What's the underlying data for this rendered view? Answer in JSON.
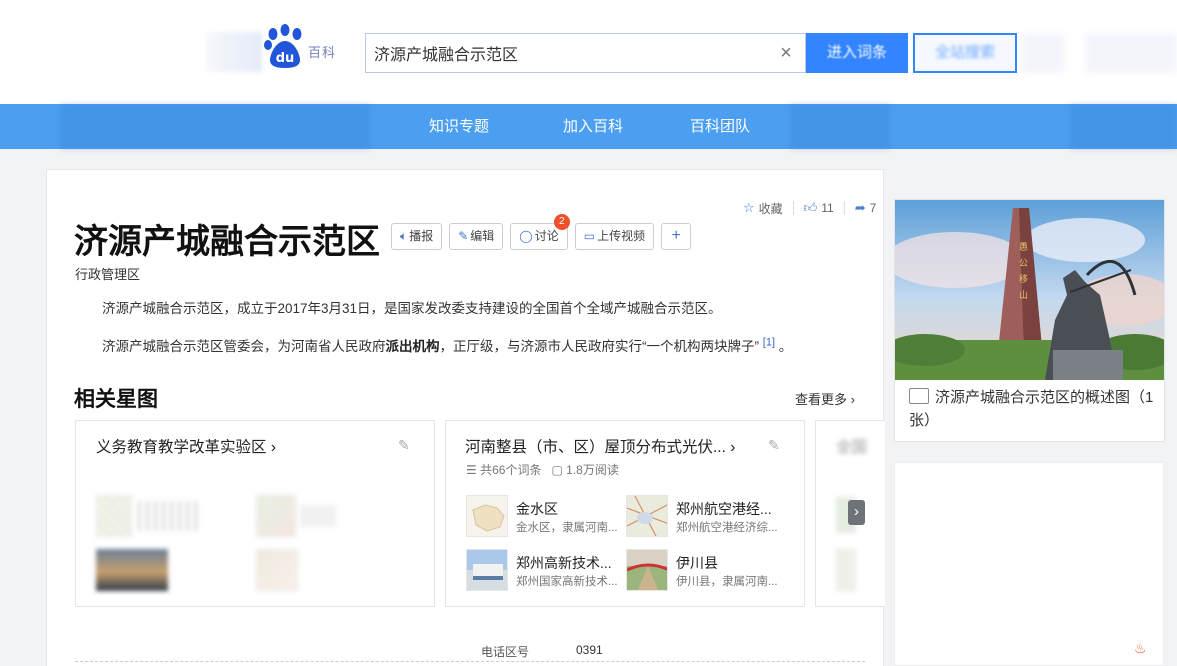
{
  "search": {
    "query": "济源产城融合示范区",
    "enter_label": "进入词条",
    "search_label": "全站搜索"
  },
  "logo": {
    "text": "du",
    "tail": "百科"
  },
  "nav": {
    "items": [
      "知识专题",
      "加入百科",
      "百科团队"
    ]
  },
  "actions": {
    "collect": "收藏",
    "like_count": "11",
    "share_count": "7"
  },
  "title": "济源产城融合示范区",
  "toolbar": {
    "play": "播报",
    "edit": "编辑",
    "discuss": "讨论",
    "discuss_badge": "2",
    "upload_video": "上传视频",
    "plus": "+"
  },
  "subtitle": "行政管理区",
  "summary": {
    "p1": "济源产城融合示范区，成立于2017年3月31日，是国家发改委支持建设的全国首个全域产城融合示范区。",
    "p2_a": "济源产城融合示范区管委会，为河南省人民政府",
    "p2_bold": "派出机构",
    "p2_b": "，正厅级，与济源市人民政府实行“一个机构两块牌子”",
    "p2_ref": "[1]",
    "p2_end": "。"
  },
  "related": {
    "section_title": "相关星图",
    "see_more": "查看更多",
    "card1": {
      "title": "义务教育教学改革实验区"
    },
    "card2": {
      "title": "河南整县（市、区）屋顶分布式光伏...",
      "count": "共66个词条",
      "reads": "1.8万阅读",
      "entries": [
        {
          "name": "金水区",
          "desc": "金水区，隶属河南..."
        },
        {
          "name": "郑州航空港经...",
          "desc": "郑州航空港经济综..."
        },
        {
          "name": "郑州高新技术...",
          "desc": "郑州国家高新技术..."
        },
        {
          "name": "伊川县",
          "desc": "伊川县，隶属河南..."
        }
      ]
    },
    "card3": {
      "title": "全国"
    }
  },
  "basic_info": {
    "label": "电话区号",
    "value": "0391"
  },
  "album": {
    "caption": "济源产城融合示范区的概述图（1张）"
  },
  "colors": {
    "nav": "#4c9ff0",
    "accent": "#3385ff",
    "badge": "#f0502c"
  },
  "icons": [
    "search-clear-icon",
    "star-icon",
    "thumb-up-icon",
    "share-icon",
    "speaker-icon",
    "pencil-icon",
    "chat-icon",
    "video-icon",
    "chevron-right-icon",
    "book-icon",
    "picture-icon",
    "flame-icon"
  ]
}
